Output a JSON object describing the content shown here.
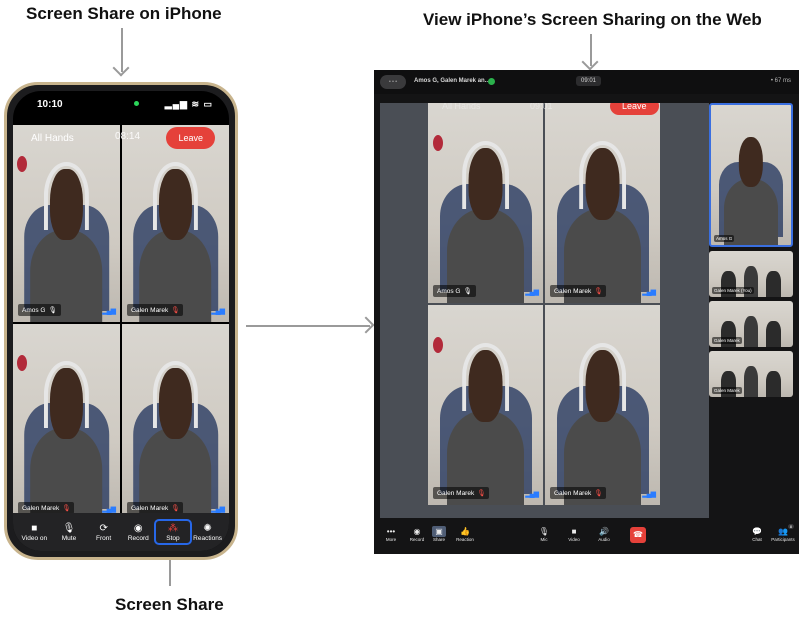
{
  "captions": {
    "left": "Screen Share on iPhone",
    "right": "View iPhone’s Screen Sharing on the Web",
    "bottom": "Screen Share"
  },
  "phone": {
    "status_time": "10:10",
    "status_icons": "▂▄▆ ≋ ▭",
    "meeting_name": "All Hands",
    "meeting_timer": "08:14",
    "leave_label": "Leave",
    "tiles": [
      {
        "name": "Amos G",
        "mic": "🎙",
        "muted": false
      },
      {
        "name": "Galen Marek",
        "mic": "🎙",
        "muted": true
      },
      {
        "name": "Galen Marek",
        "mic": "🎙",
        "muted": true
      },
      {
        "name": "Galen Marek",
        "mic": "🎙",
        "muted": true
      }
    ],
    "toolbar": [
      {
        "label": "Video on",
        "icon": "■"
      },
      {
        "label": "Mute",
        "icon": "🎙"
      },
      {
        "label": "Front",
        "icon": "⟳"
      },
      {
        "label": "Record",
        "icon": "◉"
      },
      {
        "label": "Stop",
        "icon": "⁂"
      },
      {
        "label": "Reactions",
        "icon": "✺"
      }
    ]
  },
  "web": {
    "pill": "• • •",
    "title": "Amos G, Galen Marek an...",
    "timer": "09:01",
    "stats": "• 67 ms",
    "shared": {
      "meeting_name": "All Hands",
      "meeting_timer": "09:01",
      "leave_label": "Leave",
      "tiles": [
        {
          "name": "Amos G",
          "mic": "🎙",
          "muted": false
        },
        {
          "name": "Galen Marek",
          "mic": "🎙",
          "muted": true
        },
        {
          "name": "Galen Marek",
          "mic": "🎙",
          "muted": true
        },
        {
          "name": "Galen Marek",
          "mic": "🎙",
          "muted": true
        }
      ]
    },
    "side_tiles": [
      {
        "name": "Amos G"
      },
      {
        "name": "Galen Marek (You)"
      },
      {
        "name": "Galen Marek"
      },
      {
        "name": "Galen Marek"
      }
    ],
    "toolbar": {
      "more": {
        "label": "More",
        "icon": "•••"
      },
      "record": {
        "label": "Record",
        "icon": "◉"
      },
      "share": {
        "label": "Share",
        "icon": "▣"
      },
      "reaction": {
        "label": "Reaction",
        "icon": "👍"
      },
      "mic": {
        "label": "Mic",
        "icon": "🎙"
      },
      "video": {
        "label": "Video",
        "icon": "■"
      },
      "audio": {
        "label": "Audio",
        "icon": "🔊"
      },
      "leave": {
        "icon": "☎"
      },
      "chat": {
        "label": "Chat",
        "icon": "💬"
      },
      "participants": {
        "label": "Participants",
        "icon": "👥",
        "count": "8"
      }
    }
  },
  "colors": {
    "accent_blue": "#2767e8",
    "leave_red": "#e5413a",
    "signal_blue": "#2a7cff"
  }
}
